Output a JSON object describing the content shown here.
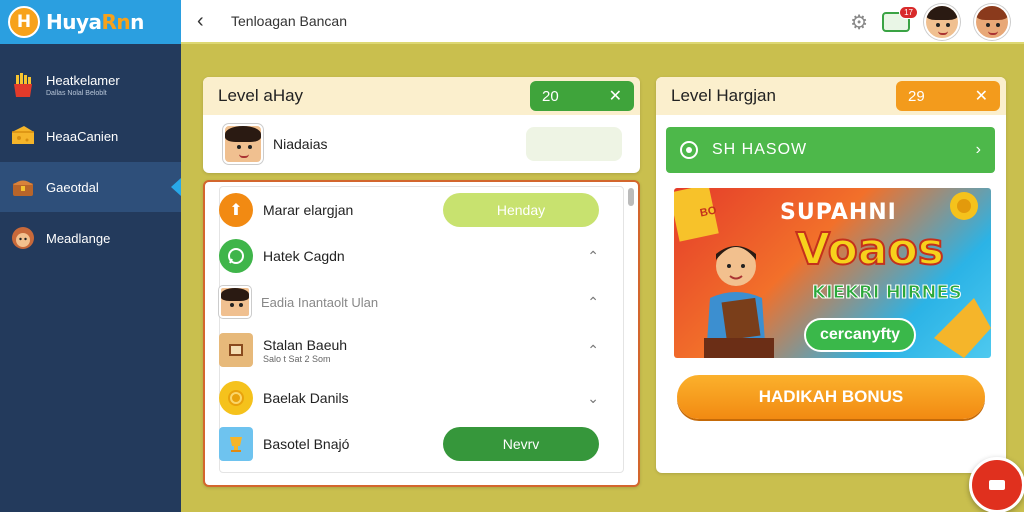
{
  "app": {
    "logo_letter": "H",
    "logo_text_a": "Huya",
    "logo_text_b": "Rn",
    "logo_text_c": "n"
  },
  "sidebar": {
    "items": [
      {
        "label": "Heatkelamer",
        "sub": "Dallas Nolal Beloblt",
        "icon": "fries-icon"
      },
      {
        "label": "HeaaCanien",
        "icon": "cheese-icon"
      },
      {
        "label": "Gaeotdal",
        "icon": "chest-icon"
      },
      {
        "label": "Meadlange",
        "icon": "face-icon"
      }
    ]
  },
  "topbar": {
    "title": "Tenloagan Bancan",
    "badge": "17"
  },
  "left": {
    "title": "Level aHay",
    "level": "20",
    "user": "Niadaias",
    "rows": [
      {
        "label": "Marar elargjan",
        "button": "Henday"
      },
      {
        "label": "Hatek Cagdn"
      },
      {
        "label": "Eadia Inantaolt Ulan"
      },
      {
        "label": "Stalan Baeuh",
        "sub": "Salo t Sat 2 Som"
      },
      {
        "label": "Baelak Danils"
      },
      {
        "label": "Basotel Bnajó",
        "button": "Nevrv"
      }
    ]
  },
  "right": {
    "title": "Level Hargjan",
    "level": "29",
    "bar_label": "SH HASOW",
    "banner": {
      "top": "SUPAHNI",
      "big": "Voaos",
      "mid": "KIEKRI HIRNES",
      "pill": "cercanyfty",
      "corner": "BO"
    },
    "bonus_button": "HADIKAH BONUS"
  },
  "colors": {
    "accent_green": "#3fa43b",
    "accent_orange": "#f39b1c",
    "sidebar": "#233a5c"
  }
}
